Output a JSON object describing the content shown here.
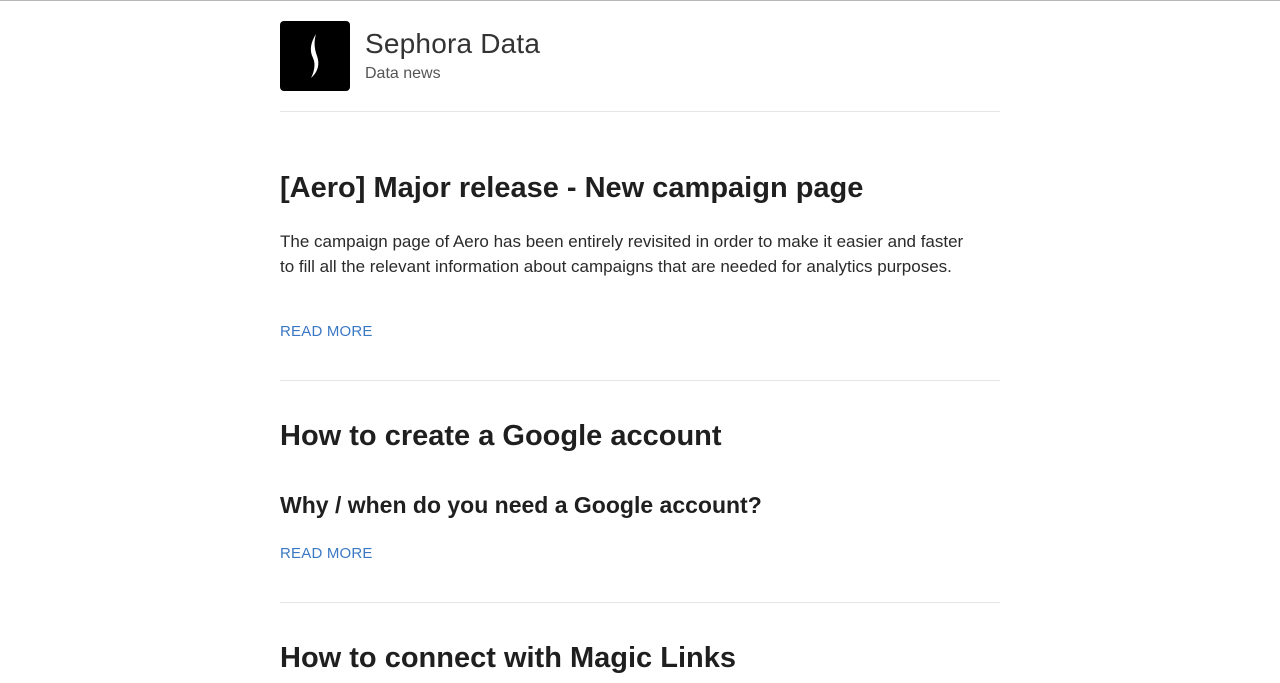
{
  "site": {
    "title": "Sephora Data",
    "subtitle": "Data news",
    "logo_icon": "sephora-flame-logo"
  },
  "posts": [
    {
      "title": "[Aero] Major release - New campaign page",
      "excerpt": "The campaign page of Aero has been entirely revisited in order to make it easier and faster to fill all the relevant information about campaigns that are needed for analytics purposes.",
      "read_more": "READ MORE"
    },
    {
      "title": "How to create a Google account",
      "subtitle": "Why / when do you need a Google account?",
      "read_more": "READ MORE"
    },
    {
      "title": "How to connect with Magic Links"
    }
  ],
  "colors": {
    "link": "#3b78c4",
    "text": "#1f1f1f",
    "divider": "#e6e6e6",
    "logo_bg": "#000000"
  }
}
